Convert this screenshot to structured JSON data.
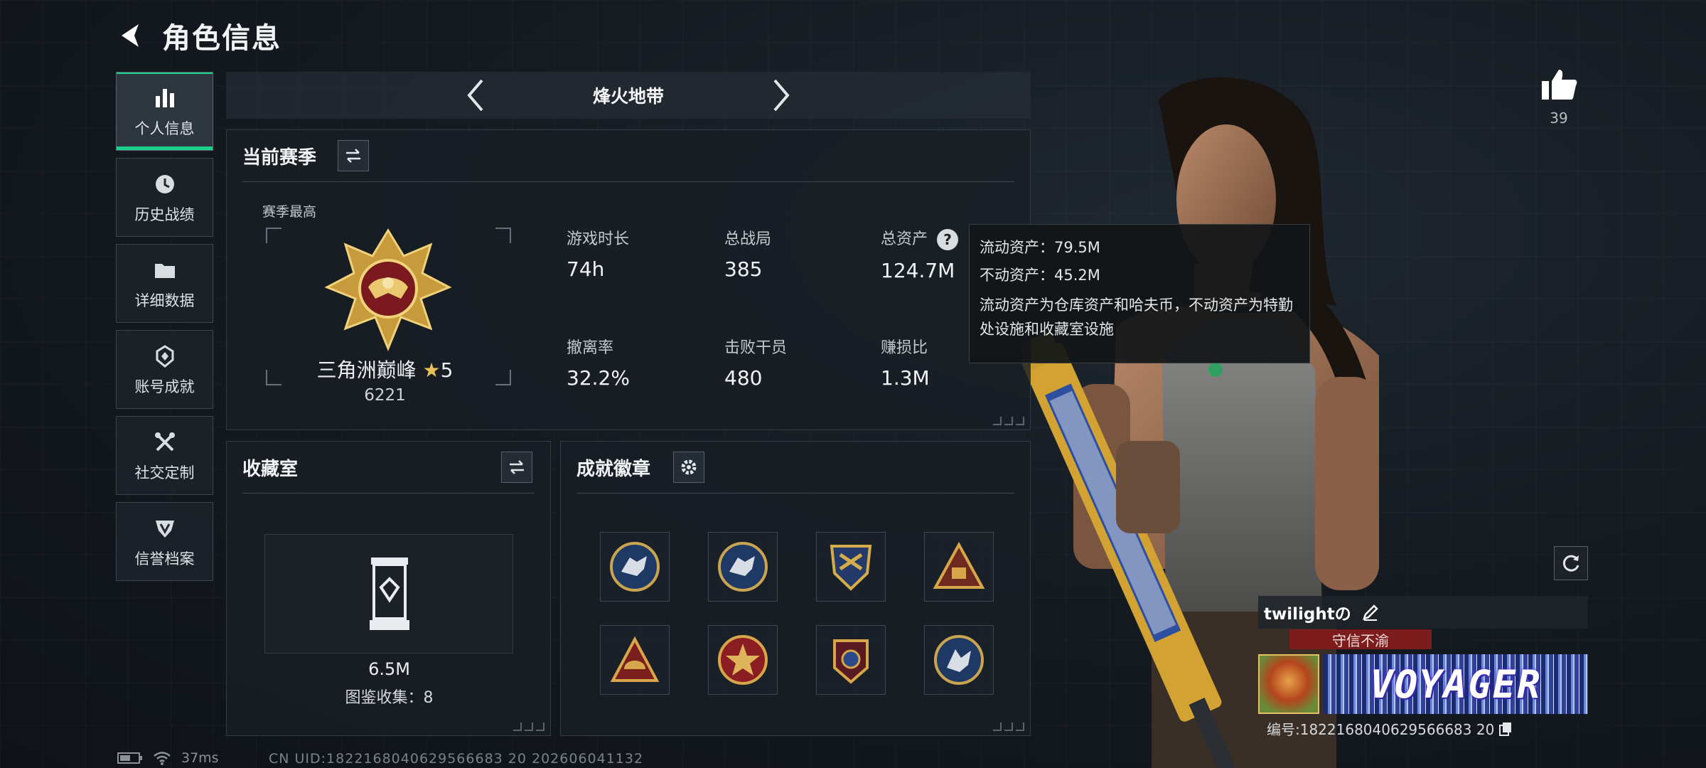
{
  "header": {
    "title": "角色信息"
  },
  "nav": {
    "items": [
      {
        "label": "个人信息",
        "icon": "bar-chart-icon",
        "active": true
      },
      {
        "label": "历史战绩",
        "icon": "clock-icon"
      },
      {
        "label": "详细数据",
        "icon": "folder-icon"
      },
      {
        "label": "账号成就",
        "icon": "achievement-icon"
      },
      {
        "label": "社交定制",
        "icon": "tools-icon"
      },
      {
        "label": "信誉档案",
        "icon": "shield-icon"
      }
    ]
  },
  "mode": {
    "title": "烽火地带"
  },
  "season": {
    "title": "当前赛季",
    "subtitle": "赛季最高",
    "rank_name": "三角洲巅峰",
    "rank_stars": "5",
    "rank_score": "6221",
    "stats": [
      {
        "label": "游戏时长",
        "value": "74h"
      },
      {
        "label": "总战局",
        "value": "385"
      },
      {
        "label": "总资产",
        "value": "124.7M"
      },
      {
        "label": "撤离率",
        "value": "32.2%"
      },
      {
        "label": "击败干员",
        "value": "480"
      },
      {
        "label": "赚损比",
        "value": "1.3M"
      }
    ]
  },
  "tooltip": {
    "liquid": "流动资产：79.5M",
    "fixed": "不动资产：45.2M",
    "description": "流动资产为仓库资产和哈夫币，不动资产为特勤处设施和收藏室设施"
  },
  "collection": {
    "title": "收藏室",
    "value": "6.5M",
    "count_text": "图鉴收集：8"
  },
  "achievements": {
    "title": "成就徽章",
    "badges": [
      "wolf-badge-icon",
      "wolf-badge-icon",
      "shield-badge-icon",
      "triangle-badge-icon",
      "helmet-badge-icon",
      "star-badge-icon",
      "emblem-badge-icon",
      "wolf-badge-icon"
    ]
  },
  "like": {
    "count": "39"
  },
  "profile": {
    "name": "twilightの",
    "motto": "守信不渝",
    "banner_text": "VOYAGER",
    "id_text": "编号:1822168040629566683 20"
  },
  "status": {
    "ping": "37ms",
    "uid_text": "CN UID:1822168040629566683 20 202606041132"
  },
  "colors": {
    "accent": "#1bd18a",
    "motto": "#7d1c1c"
  }
}
